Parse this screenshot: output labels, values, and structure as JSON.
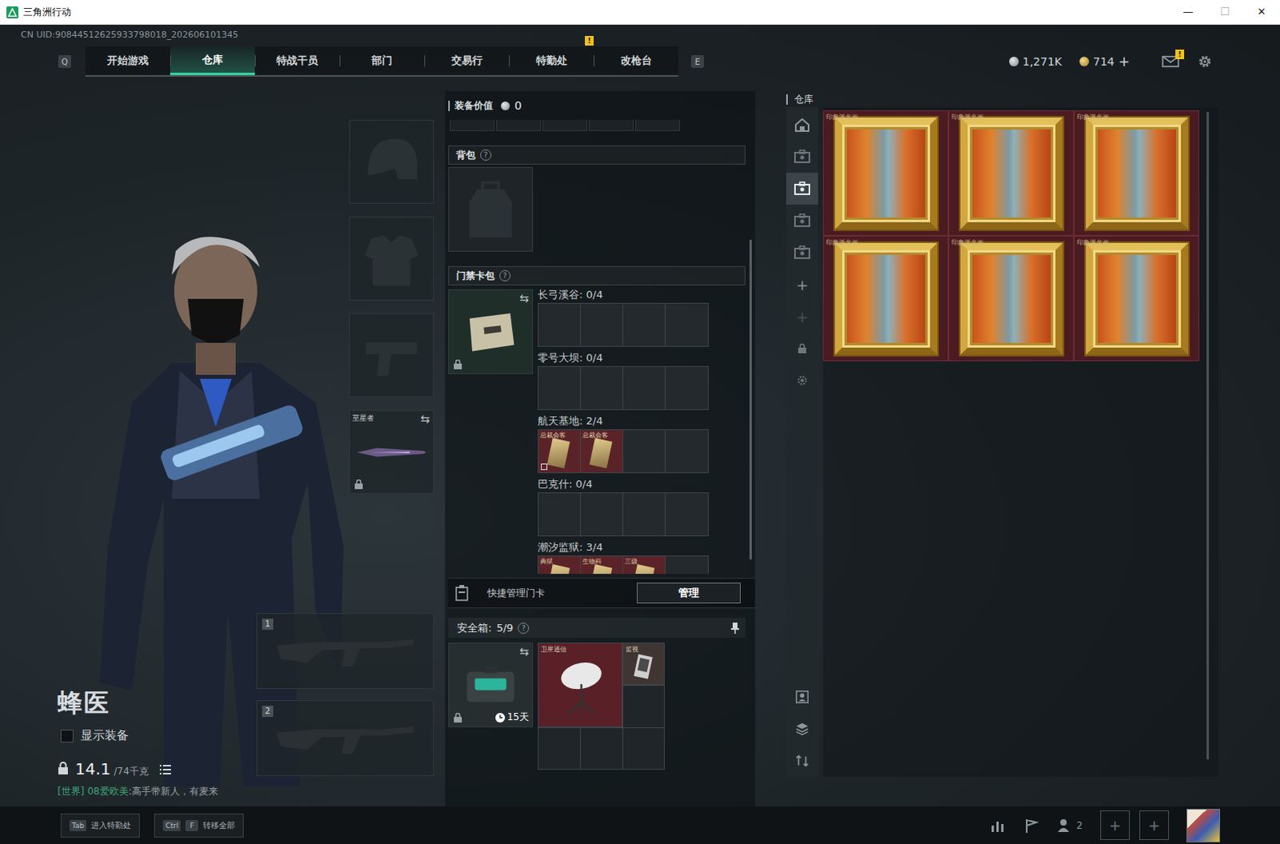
{
  "window": {
    "title": "三角洲行动",
    "controls": [
      {
        "label": "—",
        "kind": "minimize"
      },
      {
        "label": "☐",
        "kind": "maximize"
      },
      {
        "label": "✕",
        "kind": "close"
      }
    ]
  },
  "uid": "CN UID:90844512625933798018_202606101345",
  "nav": {
    "prev_key": "Q",
    "next_key": "E",
    "tabs": [
      {
        "label": "开始游戏",
        "selected": false,
        "badge": ""
      },
      {
        "label": "仓库",
        "selected": true,
        "badge": ""
      },
      {
        "label": "特战干员",
        "selected": false,
        "badge": ""
      },
      {
        "label": "部门",
        "selected": false,
        "badge": ""
      },
      {
        "label": "交易行",
        "selected": false,
        "badge": ""
      },
      {
        "label": "特勤处",
        "selected": false,
        "badge": "!"
      },
      {
        "label": "改枪台",
        "selected": false,
        "badge": ""
      }
    ]
  },
  "currencies": [
    {
      "kind": "coin",
      "value": "1,271K",
      "add": ""
    },
    {
      "kind": "bond",
      "value": "714",
      "add": "+"
    }
  ],
  "mail": {
    "badge": "!"
  },
  "operator": {
    "name": "蜂医",
    "show_equipment": {
      "label": "显示装备",
      "checked": false
    },
    "weight": {
      "value": "14.1",
      "max": "/74千克"
    }
  },
  "chat": {
    "channel": "[世界]",
    "user": "08爱欧美",
    "message": ":高手带新人，有麦来"
  },
  "equipment_slots": [
    {
      "kind": "helmet",
      "label": "",
      "locked": false,
      "swappable": false
    },
    {
      "kind": "armor",
      "label": "",
      "locked": false,
      "swappable": false
    },
    {
      "kind": "pistol",
      "label": "",
      "locked": false,
      "swappable": false
    },
    {
      "kind": "melee",
      "label": "至星者",
      "locked": true,
      "swappable": true
    }
  ],
  "weapon_slots": [
    {
      "number": "1"
    },
    {
      "number": "2"
    }
  ],
  "loadout": {
    "value_label": "装备价值",
    "value": "0",
    "backpack": {
      "label": "背包",
      "help": "?"
    },
    "card_pack": {
      "label": "门禁卡包",
      "help": "?",
      "locked": true,
      "maps": [
        {
          "name": "长弓溪谷",
          "count": "0/4",
          "slots": 4,
          "cards": []
        },
        {
          "name": "零号大坝",
          "count": "0/4",
          "slots": 4,
          "cards": []
        },
        {
          "name": "航天基地",
          "count": "2/4",
          "slots": 4,
          "cards": [
            {
              "label": "总裁会客",
              "marked": true
            },
            {
              "label": "总裁会客",
              "marked": false
            }
          ]
        },
        {
          "name": "巴克什",
          "count": "0/4",
          "slots": 4,
          "cards": []
        },
        {
          "name": "潮汐监狱",
          "count": "3/4",
          "slots": 4,
          "cards": [
            {
              "label": "典狱",
              "marked": false
            },
            {
              "label": "生物科",
              "marked": false
            },
            {
              "label": "三级",
              "marked": false
            }
          ]
        }
      ]
    },
    "quick_manage": {
      "label": "快捷管理门卡",
      "button": "管理"
    },
    "safe_box": {
      "label": "安全箱:",
      "count": "5/9",
      "help": "?",
      "timer": "15天",
      "locked": true,
      "items": [
        {
          "label": "卫星通信",
          "size": "large",
          "color": "#5a2027"
        },
        {
          "label": "监视",
          "size": "small",
          "color": "#3f3533"
        }
      ]
    }
  },
  "warehouse": {
    "title": "仓库",
    "tabs": [
      {
        "kind": "home",
        "selected": false
      },
      {
        "kind": "case",
        "selected": false
      },
      {
        "kind": "case",
        "selected": true
      },
      {
        "kind": "case",
        "selected": false
      },
      {
        "kind": "case",
        "selected": false
      }
    ],
    "add_tabs": [
      {
        "label": "+",
        "disabled": false
      },
      {
        "label": "+",
        "disabled": true
      }
    ],
    "items": [
      {
        "label": "印象派名画"
      },
      {
        "label": "印象派名画"
      },
      {
        "label": "印象派名画"
      },
      {
        "label": "印象派名画"
      },
      {
        "label": "印象派名画"
      },
      {
        "label": "印象派名画"
      }
    ]
  },
  "bottom_bar": {
    "hints": [
      {
        "keys": [
          "Tab"
        ],
        "label": "进入特勤处"
      },
      {
        "keys": [
          "Ctrl",
          "F"
        ],
        "label": "转移全部"
      }
    ],
    "friends_count": "2",
    "add_slots": [
      "+",
      "+"
    ]
  }
}
